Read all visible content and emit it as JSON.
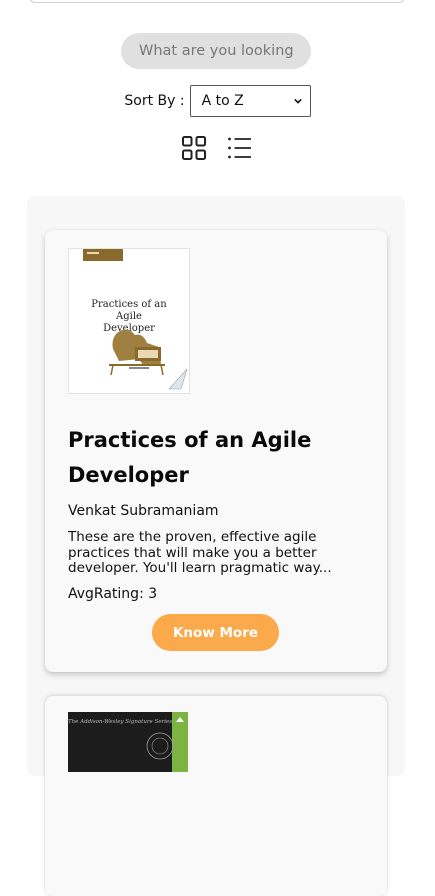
{
  "search": {
    "placeholder": "What are you looking"
  },
  "sort": {
    "label": "Sort By :",
    "selected": "A to Z"
  },
  "view_toggle": {
    "grid_icon": "grid-view-icon",
    "list_icon": "list-view-icon"
  },
  "books": [
    {
      "cover_title": "Practices of an Agile Developer",
      "title": "Practices of an Agile Developer",
      "author": "Venkat Subramaniam",
      "description": "These are the proven, effective agile practices that will make you a better developer. You'll learn pragmatic way...",
      "rating": "AvgRating: 3",
      "button_label": "Know More"
    },
    {
      "cover_title": "The Addison-Wesley Signature Series"
    }
  ],
  "colors": {
    "accent": "#fbaa4b",
    "container_bg": "#f6f7f6",
    "search_bg": "#e0e0e0",
    "cover_brown": "#8a6a2c"
  }
}
